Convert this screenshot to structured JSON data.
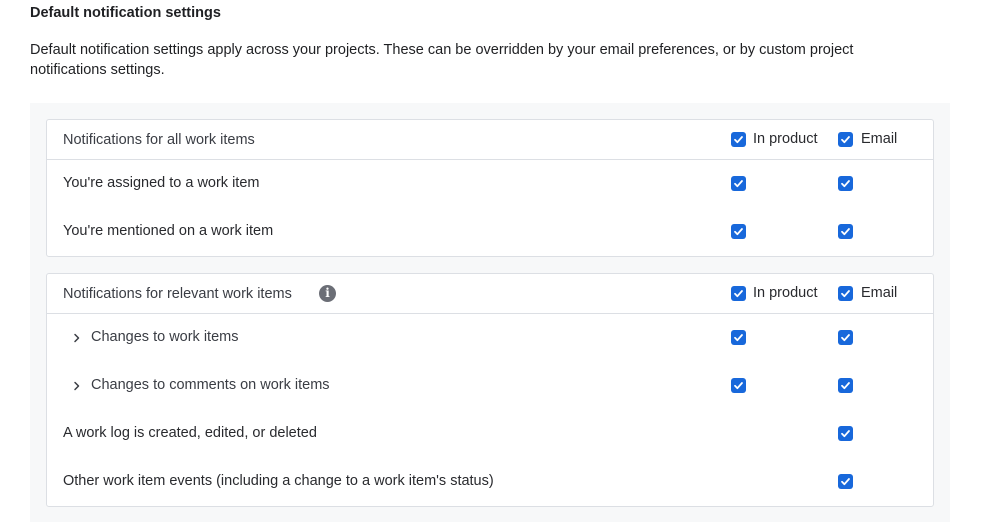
{
  "heading": "Default notification settings",
  "description": "Default notification settings apply across your projects. These can be overridden by your email preferences, or by custom project notifications settings.",
  "columns": {
    "in_product": "In product",
    "email": "Email"
  },
  "colors": {
    "checkbox": "#1868db",
    "border": "#dcdfe4",
    "panel": "#f7f8f9"
  },
  "sections": [
    {
      "title": "Notifications for all work items",
      "header_in_product": true,
      "header_email": true,
      "rows": [
        {
          "label": "You're assigned to a work item",
          "in_product": true,
          "email": true,
          "expandable": false
        },
        {
          "label": "You're mentioned on a work item",
          "in_product": true,
          "email": true,
          "expandable": false
        }
      ]
    },
    {
      "title": "Notifications for relevant work items",
      "info_icon": "info-icon",
      "header_in_product": true,
      "header_email": true,
      "rows": [
        {
          "label": "Changes to work items",
          "in_product": true,
          "email": true,
          "expandable": true
        },
        {
          "label": "Changes to comments on work items",
          "in_product": true,
          "email": true,
          "expandable": true
        },
        {
          "label": "A work log is created, edited, or deleted",
          "in_product": null,
          "email": true,
          "expandable": false
        },
        {
          "label": "Other work item events (including a change to a work item's status)",
          "in_product": null,
          "email": true,
          "expandable": false
        }
      ]
    }
  ]
}
